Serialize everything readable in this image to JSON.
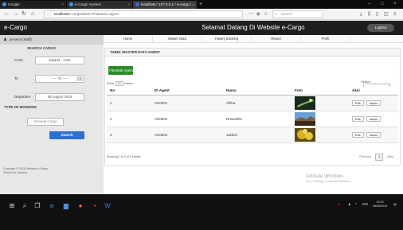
{
  "browser": {
    "tabs": [
      {
        "label": "Google"
      },
      {
        "label": "e-Cargo System"
      },
      {
        "label": "localhost / 127.0.0.1 / e-cargo / ..."
      }
    ],
    "url_prefix": "localhost/",
    "url_path": "e-cargo/admin/?halaman=agent",
    "search_placeholder": "Search"
  },
  "header": {
    "brand": "e-Cargo",
    "welcome": "Selamat Datang Di Website e-Cargo",
    "logout_label": "LogOut"
  },
  "sidebar": {
    "user": "jessens (Staff)",
    "title": "SEARCH CARGO",
    "from_label": "From",
    "from_value": "Jakarta - CGK",
    "to_label": "To",
    "to_value": "---- To ----",
    "departure_label": "Departure",
    "departure_value": "08 August 2018",
    "type_label": "TYPE OF BOOKING",
    "cargo_value": "General Cargo",
    "search_label": "Search",
    "copyright_1": "Copyright © 2018 Website e-Cargo",
    "copyright_2": "Theme by Jessens"
  },
  "nav": {
    "items": [
      "Home",
      "Master Data",
      "History Booking",
      "Report",
      "Profil"
    ]
  },
  "panel": {
    "title": "TABEL MASTER DATA AGENT",
    "add_label": "+Tambah Agent",
    "show_label": "Show",
    "show_value": "10",
    "entries_label": "entries",
    "search_label": "Search:",
    "columns": [
      "No",
      "ID Agent",
      "Nama",
      "Foto",
      "Aksi"
    ],
    "rows": [
      {
        "no": "1",
        "id": "AG0001",
        "nama": "Afifna"
      },
      {
        "no": "2",
        "id": "AG0002",
        "nama": "Rumaisha"
      },
      {
        "no": "3",
        "id": "AG0003",
        "nama": "Jaelani"
      }
    ],
    "edit_label": "Edit",
    "hapus_label": "hapus",
    "info": "Showing 1 to 3 of 3 entries",
    "pager": {
      "previous": "Previous",
      "current": "1",
      "next": "Next"
    }
  },
  "watermark": {
    "line1": "Activate Windows",
    "line2": "Go to Settings to activate Windows."
  },
  "taskbar": {
    "lang": "IND",
    "time": "19:23",
    "date": "08/08/2018"
  },
  "colors": {
    "header_bg": "#1e1e1e",
    "add_button": "#2b8a2b",
    "search_button": "#2f6fd4"
  }
}
